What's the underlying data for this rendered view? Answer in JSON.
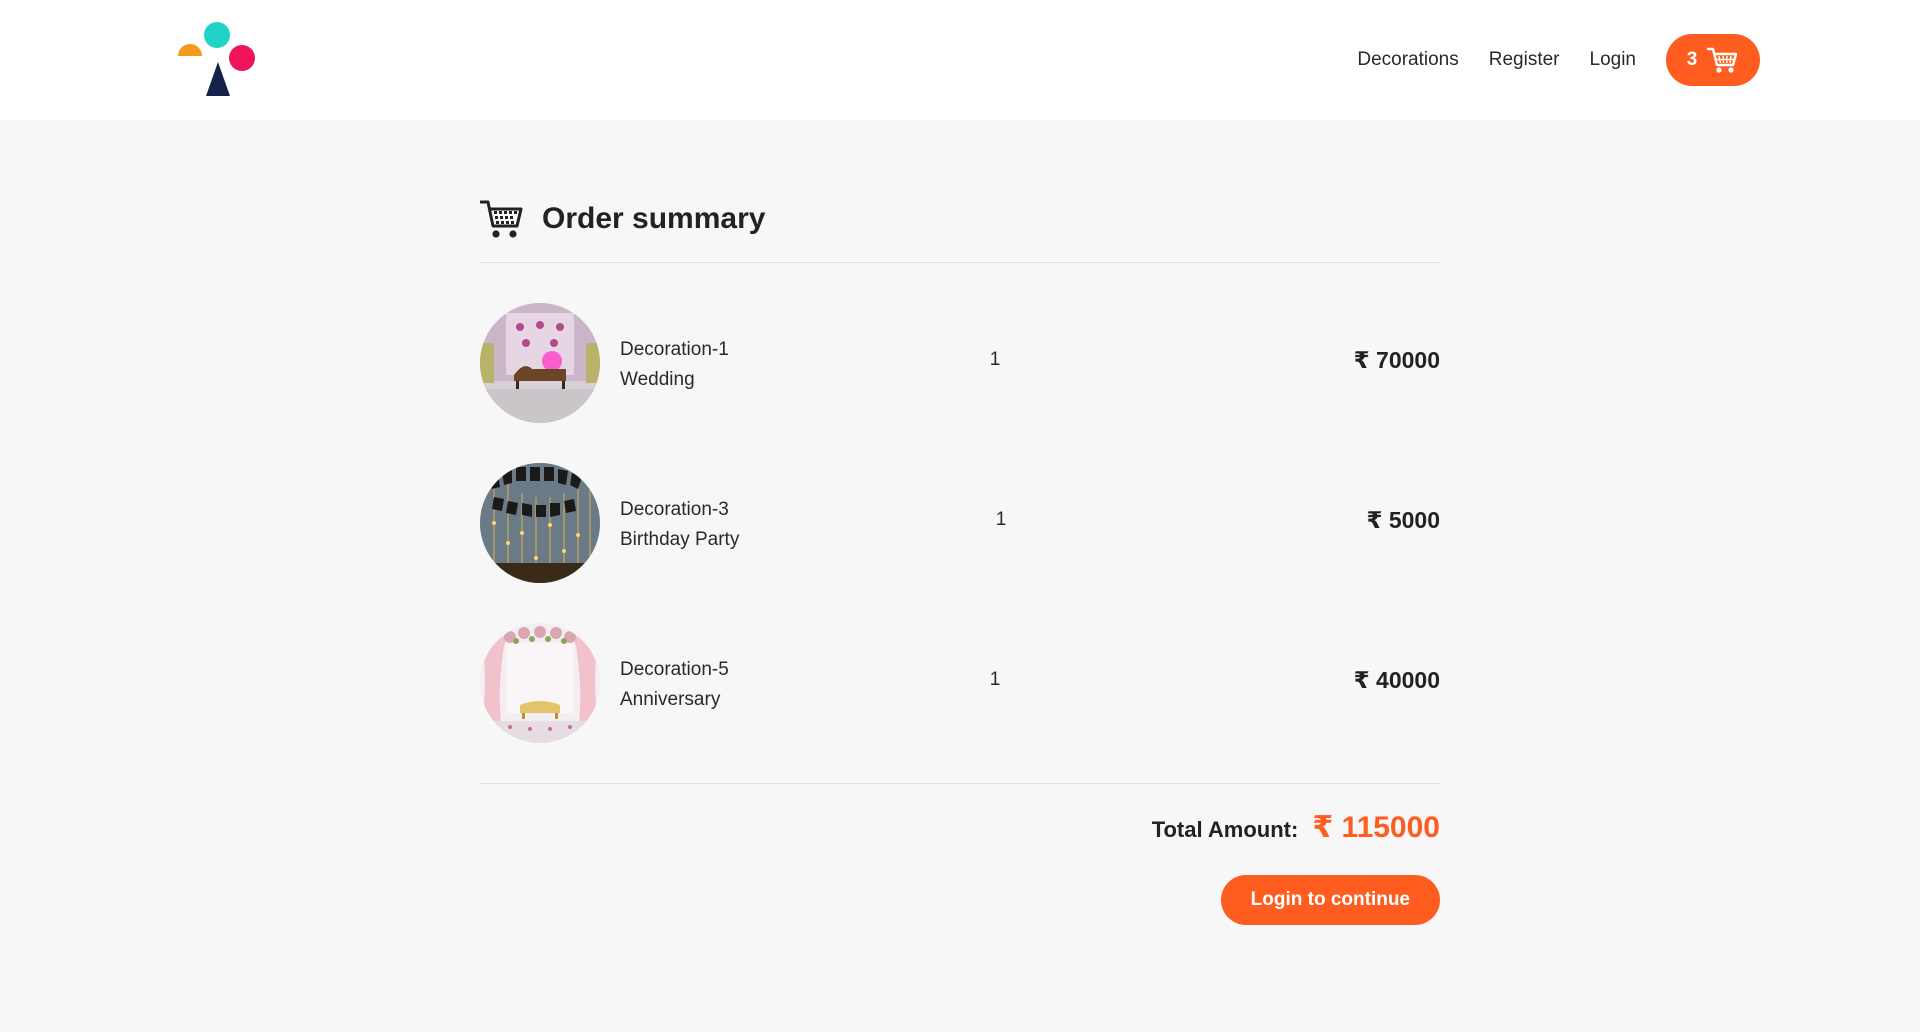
{
  "nav": {
    "links": [
      {
        "label": "Decorations"
      },
      {
        "label": "Register"
      },
      {
        "label": "Login"
      }
    ],
    "cart_count": "3"
  },
  "order": {
    "title": "Order summary",
    "currency_symbol": "₹",
    "items": [
      {
        "name": "Decoration-1",
        "category": "Wedding",
        "quantity": "1",
        "price": "₹ 70000"
      },
      {
        "name": "Decoration-3",
        "category": "Birthday Party",
        "quantity": "1",
        "price": "₹ 5000"
      },
      {
        "name": "Decoration-5",
        "category": "Anniversary",
        "quantity": "1",
        "price": "₹ 40000"
      }
    ],
    "total_label": "Total Amount:",
    "total_value": "₹ 115000",
    "action_label": "Login to continue"
  },
  "colors": {
    "accent": "#ff5d1f",
    "background": "#f7f7f7",
    "logo_teal": "#1fd3c8",
    "logo_pink": "#f0145a",
    "logo_orange": "#f59a1c",
    "logo_navy": "#16224a"
  },
  "icons": {
    "logo": "brand-logo",
    "cart": "shopping-cart-icon"
  }
}
